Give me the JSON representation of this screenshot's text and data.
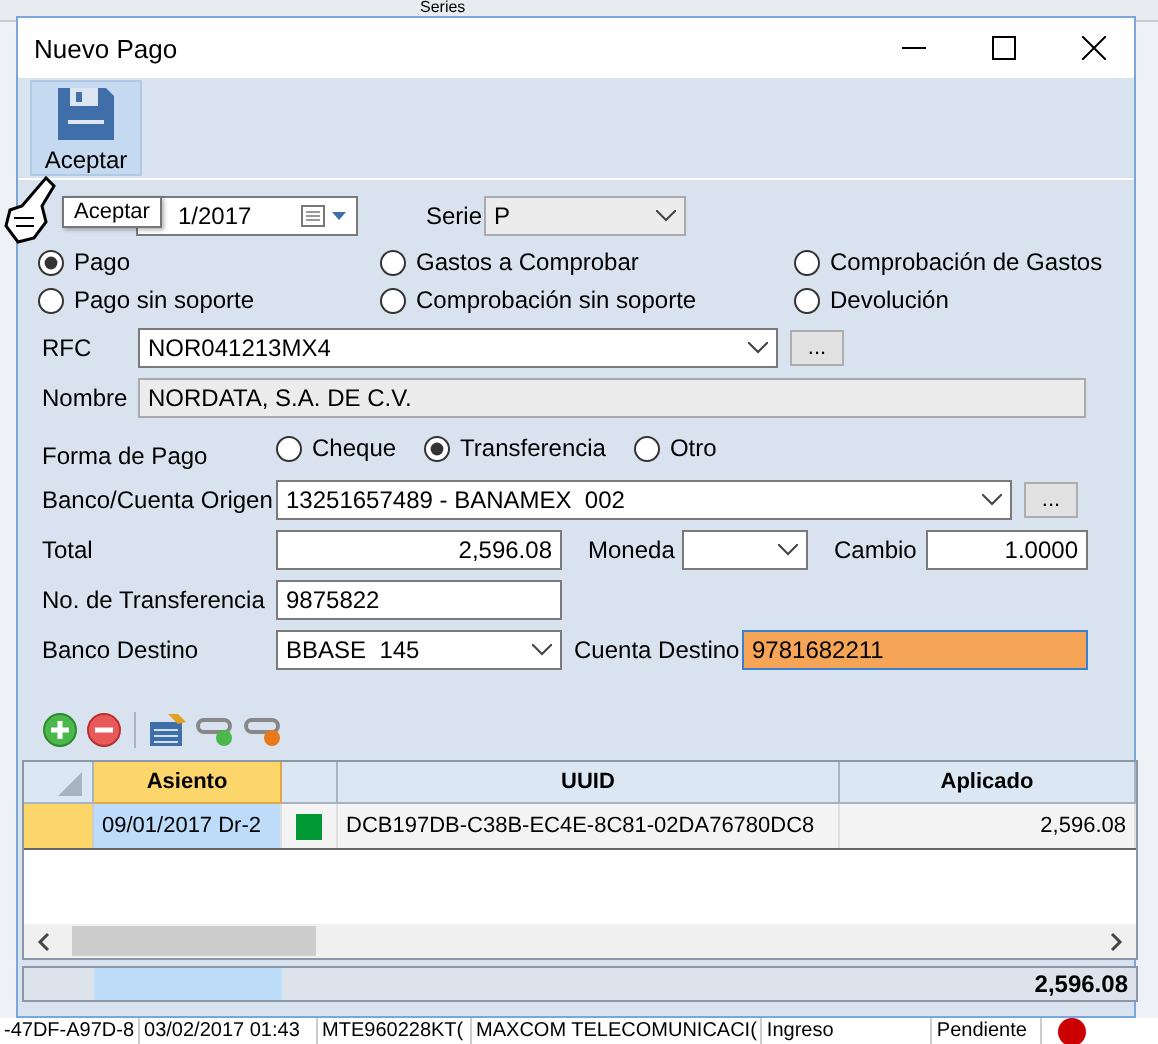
{
  "background_app": {
    "toolbar_label": "Series",
    "row_cells": [
      "-47DF-A97D-8",
      "03/02/2017 01:43",
      "MTE960228KT(",
      "MAXCOM TELECOMUNICACI(",
      "Ingreso",
      "Pendiente"
    ]
  },
  "window": {
    "title": "Nuevo Pago"
  },
  "toolbar": {
    "buttons": [
      {
        "label": "Aceptar"
      }
    ],
    "tooltip": "Aceptar"
  },
  "fecha": {
    "value": "1/2017"
  },
  "serie": {
    "label": "Serie",
    "value": "P"
  },
  "tipo": [
    {
      "label": "Pago",
      "selected": true
    },
    {
      "label": "Gastos a Comprobar",
      "selected": false
    },
    {
      "label": "Comprobación de Gastos",
      "selected": false
    },
    {
      "label": "Pago sin soporte",
      "selected": false
    },
    {
      "label": "Comprobación sin soporte",
      "selected": false
    },
    {
      "label": "Devolución",
      "selected": false
    }
  ],
  "rfc": {
    "label": "RFC",
    "value": "NOR041213MX4",
    "button": "..."
  },
  "nombre": {
    "label": "Nombre",
    "value": "NORDATA, S.A. DE C.V."
  },
  "forma_pago": {
    "label": "Forma de Pago",
    "options": [
      {
        "label": "Cheque",
        "selected": false
      },
      {
        "label": "Transferencia",
        "selected": true
      },
      {
        "label": "Otro",
        "selected": false
      }
    ]
  },
  "banco_origen": {
    "label": "Banco/Cuenta Origen",
    "value": "13251657489 - BANAMEX  002",
    "button": "..."
  },
  "total": {
    "label": "Total",
    "value": "2,596.08"
  },
  "moneda": {
    "label": "Moneda"
  },
  "cambio": {
    "label": "Cambio",
    "value": "1.0000"
  },
  "transferencia": {
    "label": "No. de Transferencia",
    "value": "9875822"
  },
  "banco_destino": {
    "label": "Banco Destino",
    "value": "BBASE  145"
  },
  "cuenta_destino": {
    "label": "Cuenta Destino",
    "value": "9781682211"
  },
  "grid": {
    "columns": [
      {
        "label": "Asiento"
      },
      {
        "label": "UUID"
      },
      {
        "label": "Aplicado"
      }
    ],
    "rows": [
      {
        "asiento": "09/01/2017 Dr-2",
        "color": "#009933",
        "uuid": "DCB197DB-C38B-EC4E-8C81-02DA76780DC8",
        "aplicado": "2,596.08",
        "selected": true
      }
    ],
    "total": "2,596.08"
  }
}
